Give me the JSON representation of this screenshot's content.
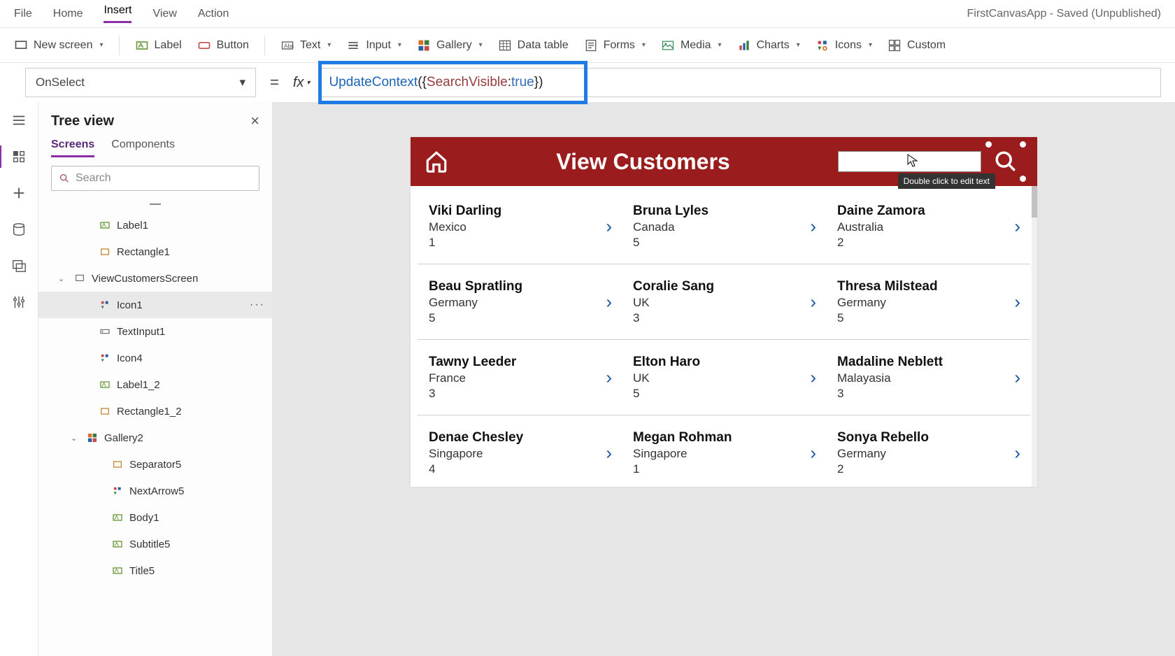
{
  "app_title": "FirstCanvasApp - Saved (Unpublished)",
  "menus": {
    "file": "File",
    "home": "Home",
    "insert": "Insert",
    "view": "View",
    "action": "Action"
  },
  "ribbon": {
    "new_screen": "New screen",
    "label": "Label",
    "button": "Button",
    "text": "Text",
    "input": "Input",
    "gallery": "Gallery",
    "data_table": "Data table",
    "forms": "Forms",
    "media": "Media",
    "charts": "Charts",
    "icons": "Icons",
    "custom": "Custom"
  },
  "property": {
    "selected": "OnSelect",
    "eq": "=",
    "fx": "fx",
    "formula_fn": "UpdateContext",
    "formula_open": "({",
    "formula_key": "SearchVisible",
    "formula_sep": ": ",
    "formula_val": "true",
    "formula_close": "})"
  },
  "treeview": {
    "title": "Tree view",
    "tab_screens": "Screens",
    "tab_components": "Components",
    "search_placeholder": "Search",
    "nodes": [
      {
        "label": "Label1",
        "icon": "label",
        "indent": 3,
        "chev": ""
      },
      {
        "label": "Rectangle1",
        "icon": "rect",
        "indent": 3,
        "chev": ""
      },
      {
        "label": "ViewCustomersScreen",
        "icon": "screen",
        "indent": 1,
        "chev": "v"
      },
      {
        "label": "Icon1",
        "icon": "iconctl",
        "indent": 3,
        "chev": "",
        "selected": true,
        "more": "···"
      },
      {
        "label": "TextInput1",
        "icon": "input",
        "indent": 3,
        "chev": ""
      },
      {
        "label": "Icon4",
        "icon": "iconctl",
        "indent": 3,
        "chev": ""
      },
      {
        "label": "Label1_2",
        "icon": "label",
        "indent": 3,
        "chev": ""
      },
      {
        "label": "Rectangle1_2",
        "icon": "rect",
        "indent": 3,
        "chev": ""
      },
      {
        "label": "Gallery2",
        "icon": "gallery",
        "indent": 2,
        "chev": "v"
      },
      {
        "label": "Separator5",
        "icon": "rect",
        "indent": 4,
        "chev": ""
      },
      {
        "label": "NextArrow5",
        "icon": "iconctl",
        "indent": 4,
        "chev": ""
      },
      {
        "label": "Body1",
        "icon": "label",
        "indent": 4,
        "chev": ""
      },
      {
        "label": "Subtitle5",
        "icon": "label",
        "indent": 4,
        "chev": ""
      },
      {
        "label": "Title5",
        "icon": "label",
        "indent": 4,
        "chev": ""
      }
    ]
  },
  "canvas": {
    "title": "View Customers",
    "tooltip": "Double click to edit text",
    "customers": [
      {
        "name": "Viki  Darling",
        "country": "Mexico",
        "num": "1"
      },
      {
        "name": "Bruna  Lyles",
        "country": "Canada",
        "num": "5"
      },
      {
        "name": "Daine  Zamora",
        "country": "Australia",
        "num": "2"
      },
      {
        "name": "Beau  Spratling",
        "country": "Germany",
        "num": "5"
      },
      {
        "name": "Coralie  Sang",
        "country": "UK",
        "num": "3"
      },
      {
        "name": "Thresa  Milstead",
        "country": "Germany",
        "num": "5"
      },
      {
        "name": "Tawny  Leeder",
        "country": "France",
        "num": "3"
      },
      {
        "name": "Elton  Haro",
        "country": "UK",
        "num": "5"
      },
      {
        "name": "Madaline  Neblett",
        "country": "Malayasia",
        "num": "3"
      },
      {
        "name": "Denae  Chesley",
        "country": "Singapore",
        "num": "4"
      },
      {
        "name": "Megan  Rohman",
        "country": "Singapore",
        "num": "1"
      },
      {
        "name": "Sonya  Rebello",
        "country": "Germany",
        "num": "2"
      }
    ]
  }
}
